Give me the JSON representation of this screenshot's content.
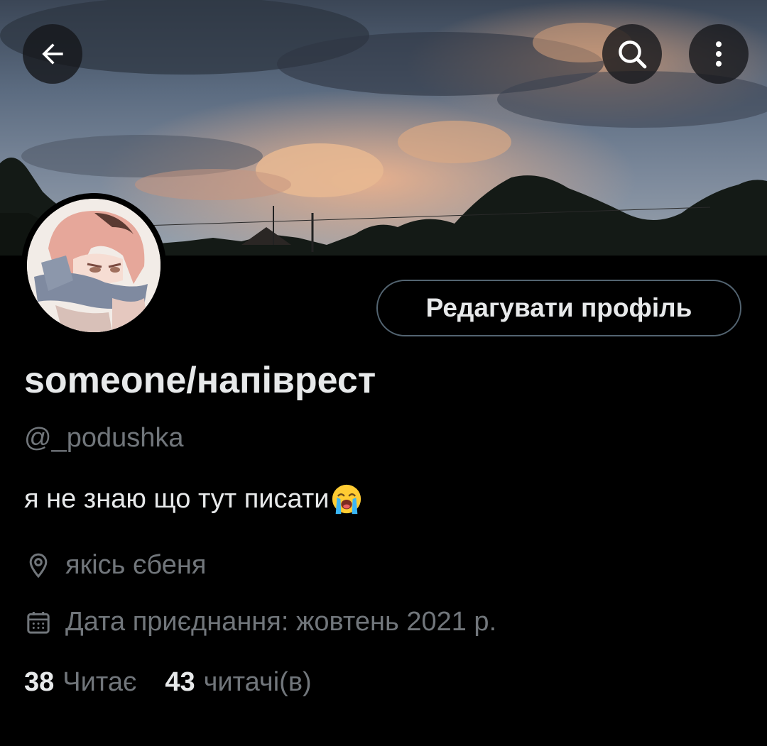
{
  "header": {
    "back_icon": "arrow-left-icon",
    "search_icon": "search-icon",
    "more_icon": "more-vertical-icon"
  },
  "profile": {
    "edit_button_label": "Редагувати профіль",
    "display_name": "someone/напіврест",
    "handle": "@_podushka",
    "bio": "я не знаю що тут писати",
    "bio_emoji": "loudly-crying-face",
    "location_icon": "location-pin-icon",
    "location": "якісь єбеня",
    "join_icon": "calendar-icon",
    "join_date": "Дата приєднання: жовтень 2021 р."
  },
  "stats": {
    "following_count": "38",
    "following_label": "Читає",
    "followers_count": "43",
    "followers_label": "читачі(в)"
  },
  "colors": {
    "background": "#000000",
    "primary_text": "#e7e9ea",
    "secondary_text": "#71767b",
    "button_border": "#536471"
  }
}
